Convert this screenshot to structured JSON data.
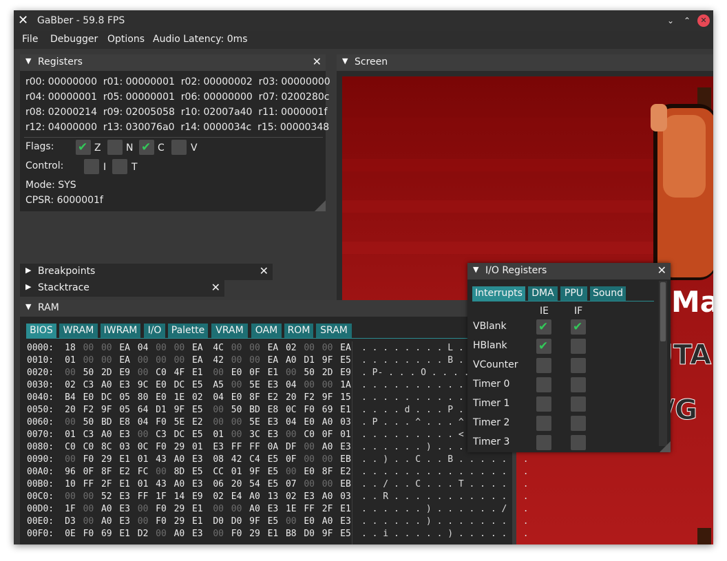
{
  "window": {
    "title": "GaBber - 59.8 FPS",
    "minimize": "⌄",
    "maximize": "⌃",
    "close": "✕"
  },
  "menu": [
    "File",
    "Debugger",
    "Options",
    "Audio Latency: 0ms"
  ],
  "registers_panel": {
    "title": "Registers",
    "rows": [
      "r00: 00000000  r01: 00000001  r02: 00000002  r03: 00000000",
      "r04: 00000001  r05: 00000001  r06: 00000000  r07: 0200280c",
      "r08: 02000214  r09: 02005058  r10: 02007a40  r11: 0000001f",
      "r12: 04000000  r13: 030076a0  r14: 0000034c  r15: 00000348"
    ],
    "flags_label": "Flags:",
    "flags": [
      {
        "name": "Z",
        "checked": true
      },
      {
        "name": "N",
        "checked": false
      },
      {
        "name": "C",
        "checked": true
      },
      {
        "name": "V",
        "checked": false
      }
    ],
    "control_label": "Control:",
    "control": [
      {
        "name": "I",
        "checked": false
      },
      {
        "name": "T",
        "checked": false
      }
    ],
    "mode": "Mode: SYS",
    "cpsr": "CPSR: 6000001f"
  },
  "screen_panel": {
    "title": "Screen"
  },
  "breakpoints_panel": {
    "title": "Breakpoints"
  },
  "stacktrace_panel": {
    "title": "Stacktrace"
  },
  "ram_panel": {
    "title": "RAM",
    "tabs": [
      "BIOS",
      "WRAM",
      "IWRAM",
      "I/O",
      "Palette",
      "VRAM",
      "OAM",
      "ROM",
      "SRAM"
    ],
    "active_tab": "BIOS",
    "rows": [
      {
        "addr": "0000:",
        "bytes": [
          "18",
          "00",
          "00",
          "EA",
          "04",
          "00",
          "00",
          "EA",
          "4C",
          "00",
          "00",
          "EA",
          "02",
          "00",
          "00",
          "EA"
        ],
        "ascii": ". . . . . . . . L . . . . . . ."
      },
      {
        "addr": "0010:",
        "bytes": [
          "01",
          "00",
          "00",
          "EA",
          "00",
          "00",
          "00",
          "EA",
          "42",
          "00",
          "00",
          "EA",
          "A0",
          "D1",
          "9F",
          "E5"
        ],
        "ascii": ". . . . . . . . B . . . . . . ."
      },
      {
        "addr": "0020:",
        "bytes": [
          "00",
          "50",
          "2D",
          "E9",
          "00",
          "C0",
          "4F",
          "E1",
          "00",
          "E0",
          "0F",
          "E1",
          "00",
          "50",
          "2D",
          "E9"
        ],
        "ascii": ". P- . . . O . . . . . . P- . ."
      },
      {
        "addr": "0030:",
        "bytes": [
          "02",
          "C3",
          "A0",
          "E3",
          "9C",
          "E0",
          "DC",
          "E5",
          "A5",
          "00",
          "5E",
          "E3",
          "04",
          "00",
          "00",
          "1A"
        ],
        "ascii": ". . . . . . . . . . ^ . . . . ."
      },
      {
        "addr": "0040:",
        "bytes": [
          "B4",
          "E0",
          "DC",
          "05",
          "80",
          "E0",
          "1E",
          "02",
          "04",
          "E0",
          "8F",
          "E2",
          "20",
          "F2",
          "9F",
          "15"
        ],
        "ascii": ". . . . . . . . . . . . . . . ."
      },
      {
        "addr": "0050:",
        "bytes": [
          "20",
          "F2",
          "9F",
          "05",
          "64",
          "D1",
          "9F",
          "E5",
          "00",
          "50",
          "BD",
          "E8",
          "0C",
          "F0",
          "69",
          "E1"
        ],
        "ascii": ". . . . d . . . P . . . . i . ."
      },
      {
        "addr": "0060:",
        "bytes": [
          "00",
          "50",
          "BD",
          "E8",
          "04",
          "F0",
          "5E",
          "E2",
          "00",
          "00",
          "5E",
          "E3",
          "04",
          "E0",
          "A0",
          "03"
        ],
        "ascii": ". P . . . ^ . . . ^ . . . . . ."
      },
      {
        "addr": "0070:",
        "bytes": [
          "01",
          "C3",
          "A0",
          "E3",
          "00",
          "C3",
          "DC",
          "E5",
          "01",
          "00",
          "3C",
          "E3",
          "00",
          "C0",
          "0F",
          "01"
        ],
        "ascii": ". . . . . . . . . < . . . . . ."
      },
      {
        "addr": "0080:",
        "bytes": [
          "C0",
          "C0",
          "8C",
          "03",
          "0C",
          "F0",
          "29",
          "01",
          "E3",
          "FF",
          "FF",
          "0A",
          "DF",
          "00",
          "A0",
          "E3"
        ],
        "ascii": ". . . . . . ) . . . . . . . . ."
      },
      {
        "addr": "0090:",
        "bytes": [
          "00",
          "F0",
          "29",
          "E1",
          "01",
          "43",
          "A0",
          "E3",
          "08",
          "42",
          "C4",
          "E5",
          "0F",
          "00",
          "00",
          "EB"
        ],
        "ascii": ". . ) . . C . . B . . . . . . ."
      },
      {
        "addr": "00A0:",
        "bytes": [
          "96",
          "0F",
          "8F",
          "E2",
          "FC",
          "00",
          "8D",
          "E5",
          "CC",
          "01",
          "9F",
          "E5",
          "00",
          "E0",
          "8F",
          "E2"
        ],
        "ascii": ". . . . . . . . . . . . . . . ."
      },
      {
        "addr": "00B0:",
        "bytes": [
          "10",
          "FF",
          "2F",
          "E1",
          "01",
          "43",
          "A0",
          "E3",
          "06",
          "20",
          "54",
          "E5",
          "07",
          "00",
          "00",
          "EB"
        ],
        "ascii": ". . / . . C . . . T . . . . . ."
      },
      {
        "addr": "00C0:",
        "bytes": [
          "00",
          "00",
          "52",
          "E3",
          "FF",
          "1F",
          "14",
          "E9",
          "02",
          "E4",
          "A0",
          "13",
          "02",
          "E3",
          "A0",
          "03"
        ],
        "ascii": ". . R . . . . . . . . . . . . ."
      },
      {
        "addr": "00D0:",
        "bytes": [
          "1F",
          "00",
          "A0",
          "E3",
          "00",
          "F0",
          "29",
          "E1",
          "00",
          "00",
          "A0",
          "E3",
          "1E",
          "FF",
          "2F",
          "E1"
        ],
        "ascii": ". . . . . . ) . . . . . . / . ."
      },
      {
        "addr": "00E0:",
        "bytes": [
          "D3",
          "00",
          "A0",
          "E3",
          "00",
          "F0",
          "29",
          "E1",
          "D0",
          "D0",
          "9F",
          "E5",
          "00",
          "E0",
          "A0",
          "E3"
        ],
        "ascii": ". . . . . . ) . . . . . . . . ."
      },
      {
        "addr": "00F0:",
        "bytes": [
          "0E",
          "F0",
          "69",
          "E1",
          "D2",
          "00",
          "A0",
          "E3",
          "00",
          "F0",
          "29",
          "E1",
          "B8",
          "D0",
          "9F",
          "E5"
        ],
        "ascii": ". . i . . . . . ) . . . . . . ."
      }
    ]
  },
  "io_panel": {
    "title": "I/O Registers",
    "tabs": [
      "Interrupts",
      "DMA",
      "PPU",
      "Sound"
    ],
    "active_tab": "Interrupts",
    "col_ie": "IE",
    "col_if": "IF",
    "rows": [
      {
        "name": "VBlank",
        "ie": true,
        "if": true
      },
      {
        "name": "HBlank",
        "ie": true,
        "if": false
      },
      {
        "name": "VCounter",
        "ie": false,
        "if": false
      },
      {
        "name": "Timer 0",
        "ie": false,
        "if": false
      },
      {
        "name": "Timer 1",
        "ie": false,
        "if": false
      },
      {
        "name": "Timer 2",
        "ie": false,
        "if": false
      },
      {
        "name": "Timer 3",
        "ie": false,
        "if": false
      }
    ]
  },
  "colors": {
    "accent": "#1e6f74",
    "check": "#34c759",
    "close": "#e84855",
    "zero_byte": "#6e6e6e"
  },
  "icons": {
    "app": "close-x-icon",
    "check": "checkmark-icon",
    "collapse": "triangle-down-icon",
    "expand": "triangle-right-icon"
  }
}
